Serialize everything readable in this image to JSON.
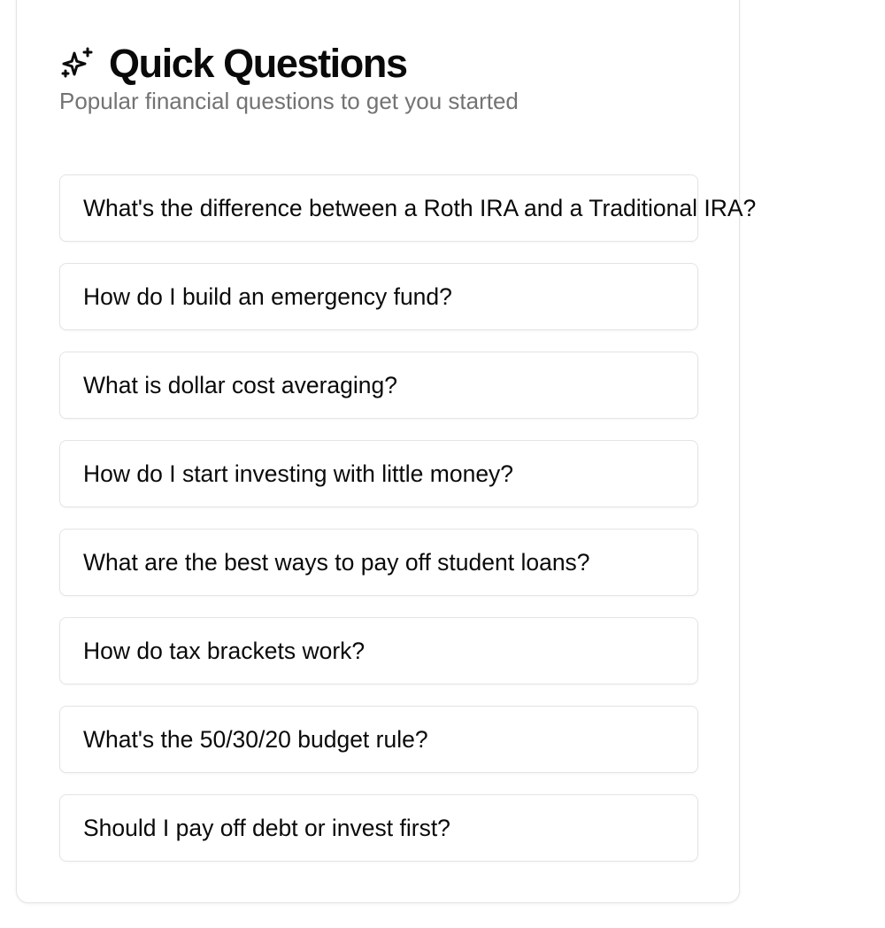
{
  "header": {
    "title": "Quick Questions",
    "subtitle": "Popular financial questions to get you started",
    "icon": "sparkle-icon"
  },
  "questions": [
    {
      "label": "What's the difference between a Roth IRA and a Traditional IRA?"
    },
    {
      "label": "How do I build an emergency fund?"
    },
    {
      "label": "What is dollar cost averaging?"
    },
    {
      "label": "How do I start investing with little money?"
    },
    {
      "label": "What are the best ways to pay off student loans?"
    },
    {
      "label": "How do tax brackets work?"
    },
    {
      "label": "What's the 50/30/20 budget rule?"
    },
    {
      "label": "Should I pay off debt or invest first?"
    }
  ],
  "colors": {
    "text": "#0a0a0a",
    "muted": "#737373",
    "border": "#e4e4e7"
  }
}
